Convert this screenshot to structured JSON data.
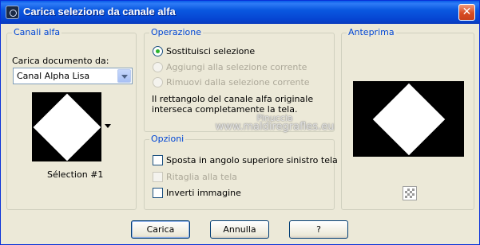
{
  "window": {
    "title": "Carica selezione da canale alfa",
    "close_label": "✕"
  },
  "canali_alfa": {
    "label": "Canali alfa",
    "doc_label": "Carica documento da:",
    "doc_selected": "Canal Alpha Lisa",
    "selection_name": "Sélection #1"
  },
  "operazione": {
    "label": "Operazione",
    "options": [
      {
        "label": "Sostituisci selezione",
        "selected": true,
        "enabled": true
      },
      {
        "label": "Aggiungi alla selezione corrente",
        "selected": false,
        "enabled": false
      },
      {
        "label": "Rimuovi dalla selezione corrente",
        "selected": false,
        "enabled": false
      }
    ],
    "info_line1": "Il rettangolo del canale alfa originale",
    "info_line2": "interseca completamente la tela."
  },
  "opzioni": {
    "label": "Opzioni",
    "options": [
      {
        "label": "Sposta in angolo superiore sinistro tela",
        "checked": false,
        "enabled": true
      },
      {
        "label": "Ritaglia alla tela",
        "checked": false,
        "enabled": false
      },
      {
        "label": "Inverti immagine",
        "checked": false,
        "enabled": true
      }
    ]
  },
  "anteprima": {
    "label": "Anteprima",
    "checker_icon": "transparency-checker-icon"
  },
  "buttons": {
    "ok": "Carica",
    "cancel": "Annulla",
    "help": "?"
  },
  "watermark": {
    "line1": "Pinuccia",
    "line2": "www.maldiregrafles.eu"
  },
  "colors": {
    "title_bar": "#0a58e0",
    "group_label": "#0046d5",
    "radio_selected": "#2cb42c",
    "close_button": "#d84b22"
  }
}
